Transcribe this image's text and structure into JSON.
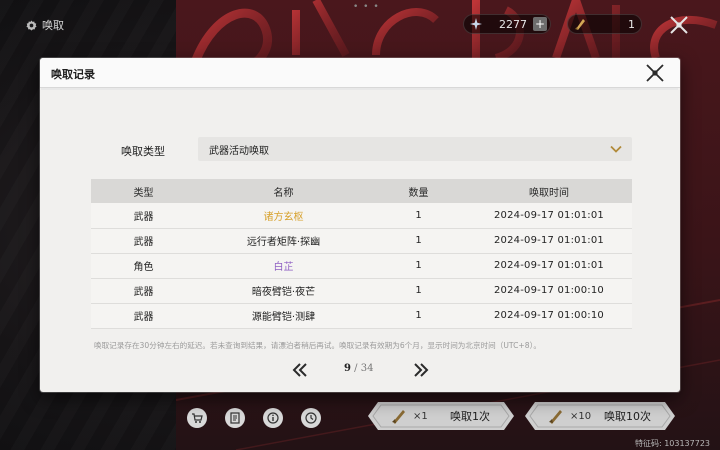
{
  "topbar": {
    "title": "唤取",
    "currency_primary": {
      "value": "2277",
      "icon": "star-crystal-icon",
      "add_label": "+"
    },
    "currency_secondary": {
      "value": "1",
      "icon": "forging-tide-icon"
    },
    "close_icon": "close-icon"
  },
  "modal": {
    "title": "唤取记录",
    "close_icon": "close-icon",
    "type_label": "唤取类型",
    "type_selected": "武器活动唤取",
    "table": {
      "headers": [
        "类型",
        "名称",
        "数量",
        "唤取时间"
      ],
      "rows": [
        {
          "type": "武器",
          "name": "诸方玄枢",
          "qty": "1",
          "time": "2024-09-17 01:01:01",
          "rarity_color": "#d7a12c"
        },
        {
          "type": "武器",
          "name": "远行者矩阵·探幽",
          "qty": "1",
          "time": "2024-09-17 01:01:01",
          "rarity_color": "#222222"
        },
        {
          "type": "角色",
          "name": "白芷",
          "qty": "1",
          "time": "2024-09-17 01:01:01",
          "rarity_color": "#8f5fc3"
        },
        {
          "type": "武器",
          "name": "暗夜臂铠·夜芒",
          "qty": "1",
          "time": "2024-09-17 01:00:10",
          "rarity_color": "#222222"
        },
        {
          "type": "武器",
          "name": "源能臂铠·测肆",
          "qty": "1",
          "time": "2024-09-17 01:00:10",
          "rarity_color": "#222222"
        }
      ]
    },
    "notice": "唤取记录存在30分钟左右的延迟。若未查询到结果，请漂泊者稍后再试。唤取记录有效期为6个月，显示时间为北京时间（UTC+8）。",
    "pagination": {
      "current": "9",
      "separator": " / ",
      "total": "34"
    }
  },
  "bottom": {
    "pull_one": {
      "multiplier": "×1",
      "label": "唤取1次"
    },
    "pull_ten": {
      "multiplier": "×10",
      "label": "唤取10次"
    },
    "uid": "特征码: 103137723"
  }
}
